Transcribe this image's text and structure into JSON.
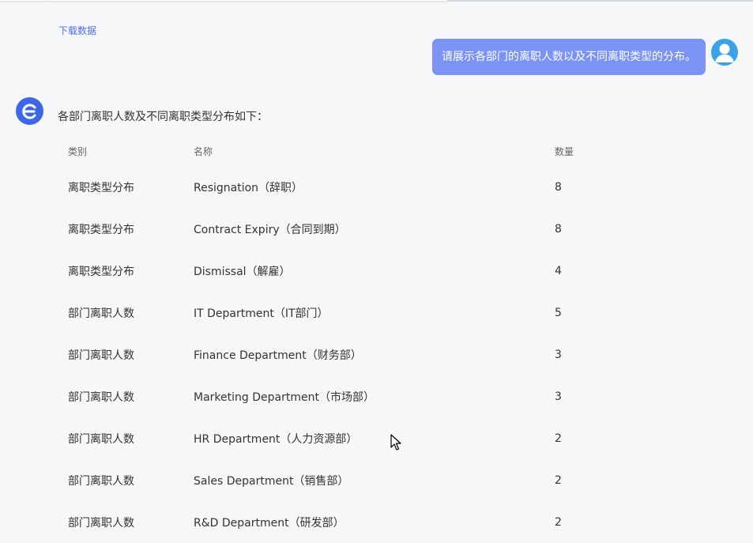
{
  "top": {
    "link_text": "下载数据"
  },
  "user_message": {
    "text": "请展示各部门的离职人数以及不同离职类型的分布。"
  },
  "bot": {
    "intro": "各部门离职人数及不同离职类型分布如下：",
    "table": {
      "headers": [
        "类别",
        "名称",
        "数量"
      ],
      "rows": [
        [
          "离职类型分布",
          "Resignation（辞职）",
          "8"
        ],
        [
          "离职类型分布",
          "Contract Expiry（合同到期）",
          "8"
        ],
        [
          "离职类型分布",
          "Dismissal（解雇）",
          "4"
        ],
        [
          "部门离职人数",
          "IT Department（IT部门）",
          "5"
        ],
        [
          "部门离职人数",
          "Finance Department（财务部）",
          "3"
        ],
        [
          "部门离职人数",
          "Marketing Department（市场部）",
          "3"
        ],
        [
          "部门离职人数",
          "HR Department（人力资源部）",
          "2"
        ],
        [
          "部门离职人数",
          "Sales Department（销售部）",
          "2"
        ],
        [
          "部门离职人数",
          "R&D Department（研发部）",
          "2"
        ]
      ]
    }
  },
  "icons": {
    "user_avatar": "user-avatar-icon",
    "bot_avatar": "bot-logo-icon",
    "cursor": "mouse-cursor-icon"
  },
  "colors": {
    "user_bubble": "#7c93f6",
    "bot_avatar": "#3d67e6",
    "user_avatar": "#3aa3e8",
    "link": "#4c6ef5"
  }
}
